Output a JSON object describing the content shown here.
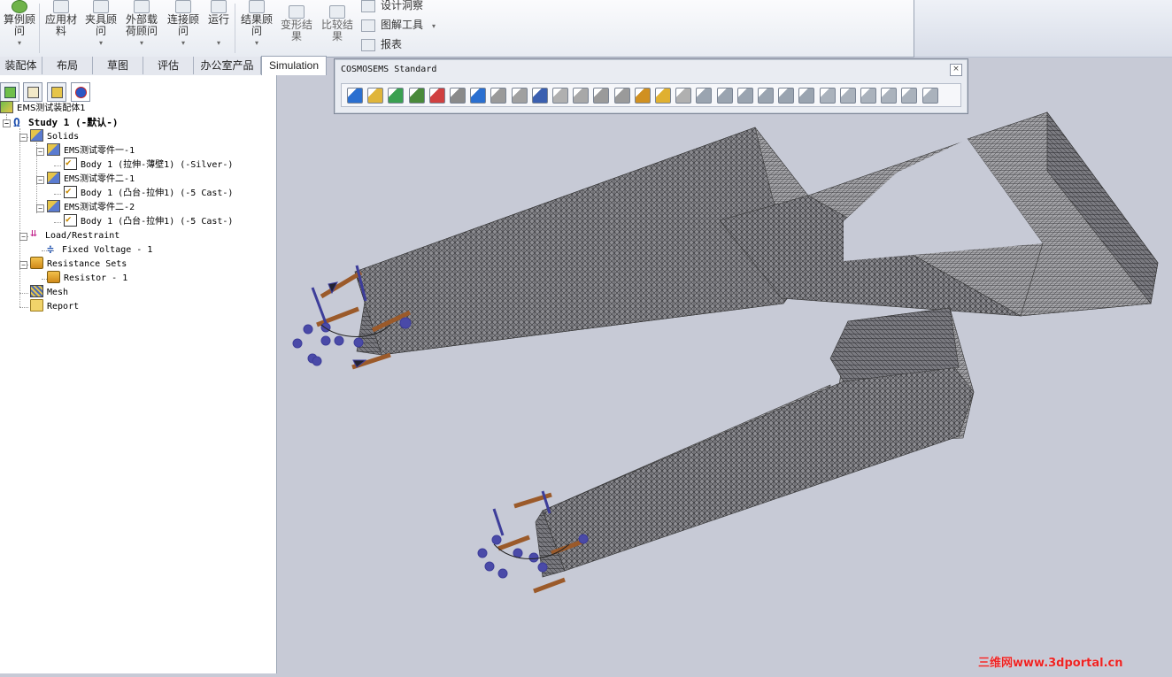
{
  "ribbon": {
    "buttons": [
      {
        "label": "算例顾问",
        "has_dropdown": true
      },
      {
        "label": "应用材料",
        "has_dropdown": false
      },
      {
        "label": "夹具顾问",
        "has_dropdown": true
      },
      {
        "label": "外部载荷顾问",
        "has_dropdown": true
      },
      {
        "label": "连接顾问",
        "has_dropdown": true
      },
      {
        "label": "运行",
        "has_dropdown": true
      },
      {
        "label": "结果顾问",
        "has_dropdown": true
      },
      {
        "label": "变形结果",
        "has_dropdown": false
      },
      {
        "label": "比较结果",
        "has_dropdown": false
      }
    ],
    "small_buttons": [
      {
        "label": "设计洞察"
      },
      {
        "label": "图解工具"
      },
      {
        "label": "报表"
      }
    ]
  },
  "tabs": [
    "装配体",
    "布局",
    "草图",
    "评估",
    "办公室产品",
    "Simulation"
  ],
  "active_tab": "Simulation",
  "tree": {
    "root": "EMS测试装配体1",
    "study": "Study 1 (-默认-)",
    "solids": "Solids",
    "parts": [
      {
        "name": "EMS测试零件一-1",
        "body": "Body 1 (拉伸-薄壁1) (-Silver-)"
      },
      {
        "name": "EMS测试零件二-1",
        "body": "Body 1 (凸台-拉伸1) (-5 Cast-)"
      },
      {
        "name": "EMS测试零件二-2",
        "body": "Body 1 (凸台-拉伸1) (-5 Cast-)"
      }
    ],
    "load_restraint": "Load/Restraint",
    "fixed_voltage": "Fixed Voltage - 1",
    "resistance_sets": "Resistance Sets",
    "resistor": "Resistor - 1",
    "mesh": "Mesh",
    "report": "Report"
  },
  "cosmos_toolbar": {
    "title": "COSMOSEMS Standard",
    "close": "×",
    "tools": [
      "new-study",
      "properties",
      "solids",
      "mesh-tool",
      "plot",
      "load",
      "fixed-voltage",
      "grid",
      "rect-tool",
      "connector",
      "rounded",
      "patch",
      "arrow-down",
      "arrow-down-2",
      "resistor",
      "folder",
      "square",
      "zoom",
      "zoom-area",
      "zoom-out",
      "rotate",
      "pan",
      "pencil",
      "view-1",
      "view-2",
      "view-3",
      "view-4",
      "view-5",
      "view-6"
    ]
  },
  "watermark": "三维网www.3dportal.cn",
  "colors": {
    "accent": "#1d4fae",
    "viewport_bg": "#c7cad6",
    "mesh_fill": "#8f8f93"
  }
}
